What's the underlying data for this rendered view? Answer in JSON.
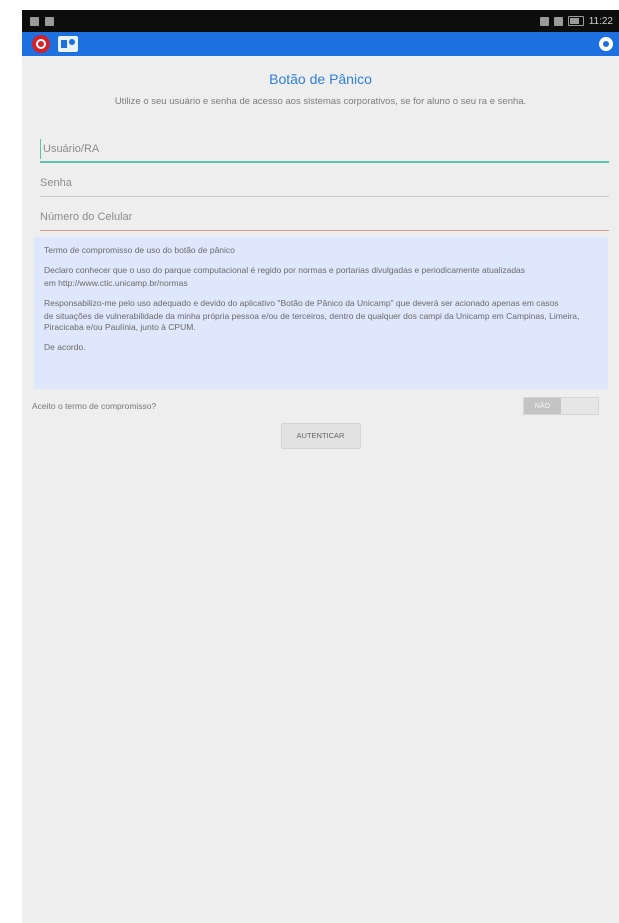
{
  "status_bar": {
    "time": "11:22"
  },
  "page": {
    "title": "Botão de Pânico",
    "instructions": "Utilize o seu usuário e senha de acesso aos sistemas corporativos, se for aluno o seu ra e senha."
  },
  "form": {
    "username_placeholder": "Usuário/RA",
    "password_placeholder": "Senha",
    "phone_placeholder": "Número do Celular"
  },
  "terms": {
    "heading": "Termo de compromisso de uso do botão de pânico",
    "paragraph1_line1": "Declaro conhecer que o uso do parque computacional é regido por normas e portarias divulgadas e periodicamente atualizadas",
    "paragraph1_line2": "em http://www.ctic.unicamp.br/normas",
    "paragraph2_line1": "Responsabilizo-me pelo uso adequado e devido do aplicativo \"Botão de Pânico da Unicamp\" que deverá ser acionado apenas em casos",
    "paragraph2_line2": "de situações de vulnerabilidade da minha própria pessoa e/ou de terceiros, dentro de qualquer dos campi da Unicamp em Campinas, Limeira, Piracicaba e/ou Paulínia, junto à CPUM.",
    "agreement": "De acordo."
  },
  "accept": {
    "label": "Aceito o termo de compromisso?",
    "toggle_off_label": "NÃO",
    "toggle_value": "off"
  },
  "actions": {
    "authenticate_label": "AUTENTICAR"
  }
}
